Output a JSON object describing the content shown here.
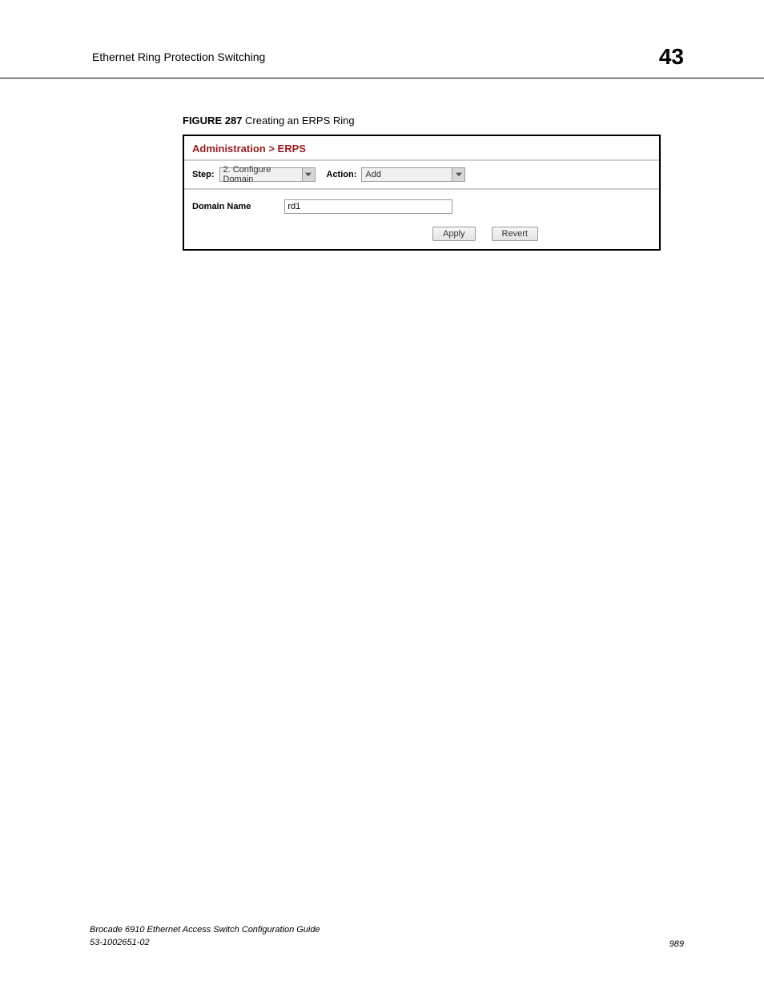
{
  "header": {
    "title": "Ethernet Ring Protection Switching",
    "chapter": "43"
  },
  "figure": {
    "label": "FIGURE 287",
    "title": "Creating an ERPS Ring"
  },
  "panel": {
    "breadcrumb": "Administration > ERPS",
    "step_label": "Step:",
    "step_value": "2. Configure Domain",
    "action_label": "Action:",
    "action_value": "Add",
    "domain_name_label": "Domain Name",
    "domain_name_value": "rd1",
    "apply_button": "Apply",
    "revert_button": "Revert"
  },
  "footer": {
    "guide": "Brocade 6910 Ethernet Access Switch Configuration Guide",
    "docnum": "53-1002651-02",
    "page": "989"
  }
}
